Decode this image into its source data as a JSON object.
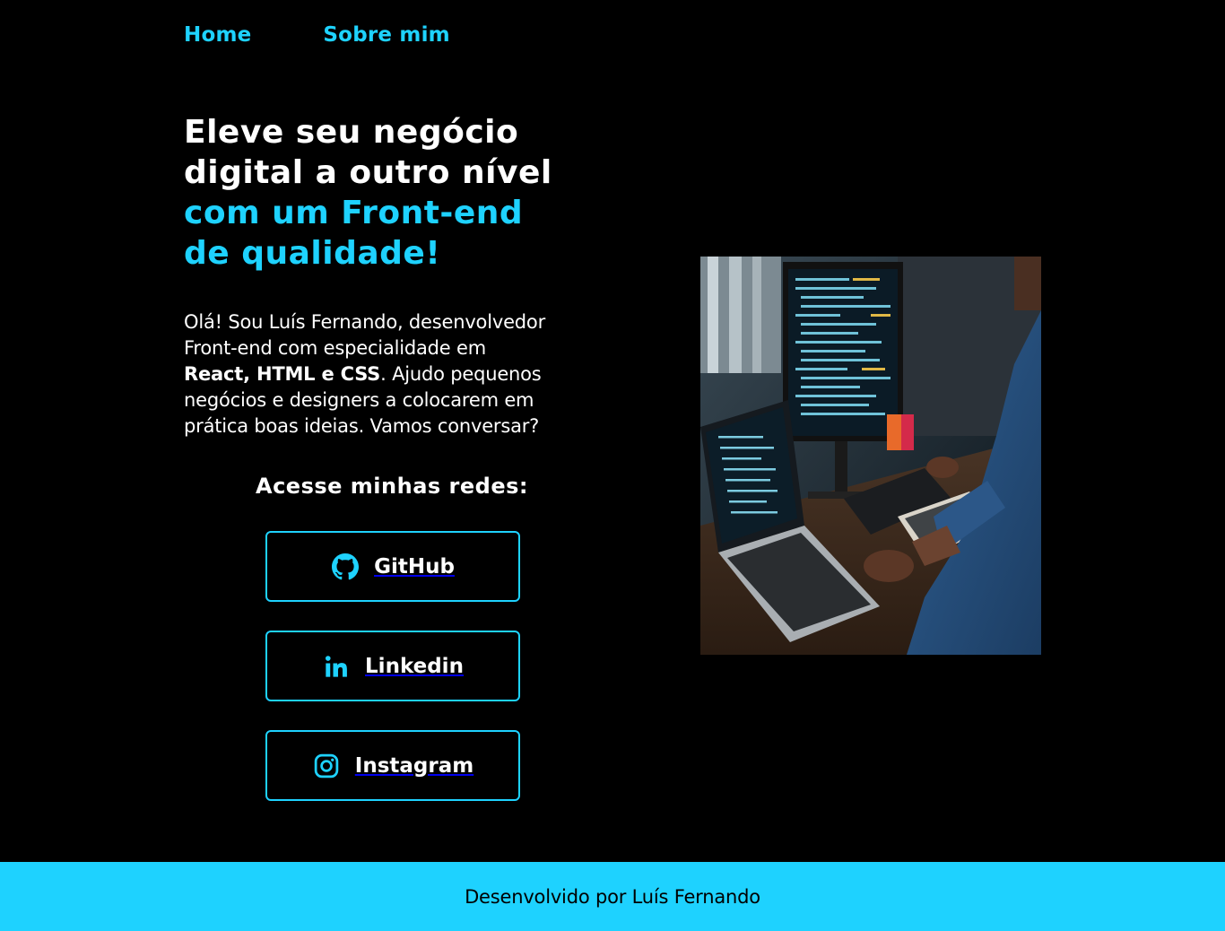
{
  "nav": {
    "items": [
      {
        "label": "Home"
      },
      {
        "label": "Sobre mim"
      }
    ]
  },
  "hero": {
    "headline_line1": "Eleve seu negócio",
    "headline_line2": "digital a outro nível",
    "headline_accent_line1": "com um Front-end",
    "headline_accent_line2": "de qualidade!",
    "intro_line1": "Olá! Sou Luís Fernando, desenvolvedor",
    "intro_line2": "Front-end com especialidade em",
    "intro_bold": "React, HTML e CSS",
    "intro_line3_rest": ". Ajudo pequenos",
    "intro_line4": "negócios e designers a colocarem em",
    "intro_line5": "prática boas ideias. Vamos conversar?"
  },
  "socials": {
    "title": "Acesse minhas redes:",
    "buttons": [
      {
        "label": "GitHub",
        "icon": "github-icon"
      },
      {
        "label": "Linkedin",
        "icon": "linkedin-icon"
      },
      {
        "label": "Instagram",
        "icon": "instagram-icon"
      }
    ]
  },
  "photo": {
    "icon": "developer-at-computer-photo"
  },
  "footer": {
    "text": "Desenvolvido por Luís Fernando"
  },
  "colors": {
    "accent": "#1ed2ff",
    "background": "#000000",
    "text": "#ffffff"
  }
}
